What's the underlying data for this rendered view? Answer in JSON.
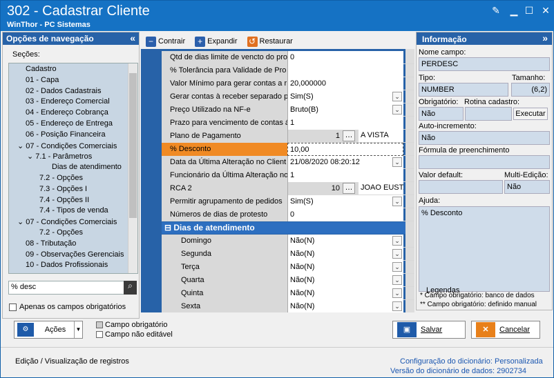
{
  "window": {
    "title": "302 - Cadastrar Cliente",
    "subtitle": "WinThor - PC Sistemas"
  },
  "nav": {
    "header": "Opções de navegação",
    "secoes_label": "Seções:",
    "tree": [
      "Cadastro",
      "01 - Capa",
      "02 - Dados Cadastrais",
      "03 - Endereço Comercial",
      "04 - Endereço Cobrança",
      "05 - Endereço de Entrega",
      "06 - Posição Financeira",
      "07 - Condições Comerciais",
      "7.1 - Parâmetros",
      "Dias de atendimento",
      "7.2 - Opções",
      "7.3 - Opções I",
      "7.4 - Opções II",
      "7.4 - Tipos de venda",
      "07 - Condições Comerciais",
      "7.2 - Opções",
      "08 - Tributação",
      "09 - Observações Gerenciais",
      "10 - Dados Profissionais"
    ],
    "search_value": "% desc",
    "only_required_label": "Apenas os campos obrigatórios"
  },
  "toolbar": {
    "contrair": "Contrair",
    "expandir": "Expandir",
    "restaurar": "Restaurar"
  },
  "grid": {
    "rows": [
      {
        "label": "Qtd de dias limite de vencto do pro",
        "value": "0"
      },
      {
        "label": "% Tolerância para Validade de Pro",
        "value": ""
      },
      {
        "label": "Valor Mínimo para gerar contas a r",
        "value": "20,000000"
      },
      {
        "label": "Gerar contas à receber separado p",
        "value": "Sim(S)"
      },
      {
        "label": "Preço Utilizado na NF-e",
        "value": "Bruto(B)"
      },
      {
        "label": "Prazo para vencimento de contas á",
        "value": "1"
      },
      {
        "label": "Plano de Pagamento",
        "value": "1",
        "extra": "A VISTA"
      },
      {
        "label": "% Desconto",
        "value": "10,00"
      },
      {
        "label": "Data da Última Alteração no Client",
        "value": "21/08/2020 08:20:12"
      },
      {
        "label": "Funcionário da Última Alteração no",
        "value": "1"
      },
      {
        "label": "RCA 2",
        "value": "10",
        "extra": "JOAO EUSTA"
      },
      {
        "label": "Permitir agrupamento de pedidos",
        "value": "Sim(S)"
      },
      {
        "label": "Números de dias de protesto",
        "value": "0"
      }
    ],
    "group": "Dias de atendimento",
    "days": [
      {
        "label": "Domingo",
        "value": "Não(N)"
      },
      {
        "label": "Segunda",
        "value": "Não(N)"
      },
      {
        "label": "Terça",
        "value": "Não(N)"
      },
      {
        "label": "Quarta",
        "value": "Não(N)"
      },
      {
        "label": "Quinta",
        "value": "Não(N)"
      },
      {
        "label": "Sexta",
        "value": "Não(N)"
      }
    ]
  },
  "info": {
    "header": "Informação",
    "nome_campo_label": "Nome campo:",
    "nome_campo": "PERDESC",
    "tipo_label": "Tipo:",
    "tipo": "NUMBER",
    "tamanho_label": "Tamanho:",
    "tamanho": "(6,2)",
    "obrigatorio_label": "Obrigatório:",
    "obrigatorio": "Não",
    "rotina_label": "Rotina cadastro:",
    "executar": "Executar",
    "autoinc_label": "Auto-incremento:",
    "autoinc": "Não",
    "formula_label": "Fórmula de preenchimento",
    "default_label": "Valor default:",
    "multi_label": "Multi-Edição:",
    "multi": "Não",
    "ajuda_label": "Ajuda:",
    "ajuda": "% Desconto",
    "legendas": "Legendas",
    "leg1": "* Campo obrigatório: banco de dados",
    "leg2": "** Campo obrigatório: definido manual"
  },
  "bottom": {
    "acoes": "Ações",
    "campo_obrigatorio": "Campo obrigatório",
    "campo_nao_editavel": "Campo não editável",
    "salvar": "Salvar",
    "cancelar": "Cancelar"
  },
  "status": {
    "left": "Edição / Visualização de registros",
    "config_label": "Configuração do dicionário:",
    "config_value": "Personalizada",
    "versao_label": "Versão do dicionário de dados:",
    "versao_value": "2902734"
  }
}
